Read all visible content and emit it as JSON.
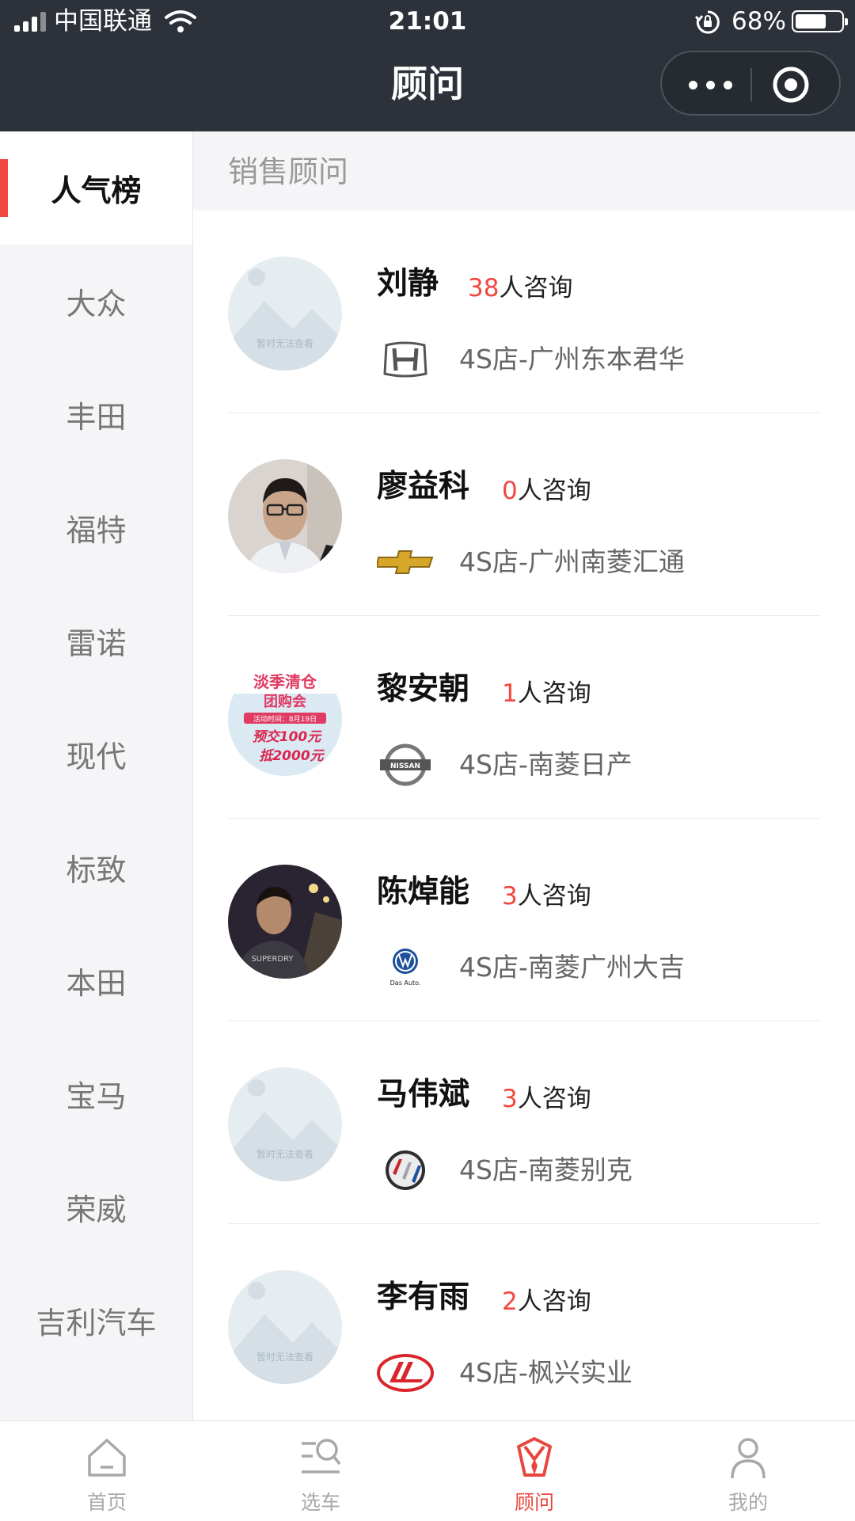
{
  "status_bar": {
    "carrier": "中国联通",
    "time": "21:01",
    "battery_percent_text": "68%",
    "battery_level": 0.68
  },
  "nav": {
    "title": "顾问",
    "more_icon": "more-dots-icon",
    "close_icon": "target-close-icon"
  },
  "sidebar": {
    "items": [
      {
        "label": "人气榜",
        "active": true
      },
      {
        "label": "大众"
      },
      {
        "label": "丰田"
      },
      {
        "label": "福特"
      },
      {
        "label": "雷诺"
      },
      {
        "label": "现代"
      },
      {
        "label": "标致"
      },
      {
        "label": "本田"
      },
      {
        "label": "宝马"
      },
      {
        "label": "荣威"
      },
      {
        "label": "吉利汽车"
      }
    ]
  },
  "list": {
    "section_title": "销售顾问",
    "consult_suffix": "人咨询",
    "advisors": [
      {
        "name": "刘静",
        "consult_count": "38",
        "store": "4S店-广州东本君华",
        "brand_icon": "honda-logo-icon",
        "avatar": "placeholder",
        "avatar_text": "暂时无法查看"
      },
      {
        "name": "廖益科",
        "consult_count": "0",
        "store": "4S店-广州南菱汇通",
        "brand_icon": "chevrolet-logo-icon",
        "avatar": "photo"
      },
      {
        "name": "黎安朝",
        "consult_count": "1",
        "store": "4S店-南菱日产",
        "brand_icon": "nissan-logo-icon",
        "avatar": "promo",
        "avatar_text": {
          "line1": "淡季清仓",
          "line2": "团购会",
          "line3": "活动时间：8月19日",
          "line4": "预交100元",
          "line5": "抵2000元"
        },
        "brand_text": "NISSAN"
      },
      {
        "name": "陈焯能",
        "consult_count": "3",
        "store": "4S店-南菱广州大吉",
        "brand_icon": "volkswagen-logo-icon",
        "avatar": "photo",
        "brand_text": "Das Auto."
      },
      {
        "name": "马伟斌",
        "consult_count": "3",
        "store": "4S店-南菱别克",
        "brand_icon": "buick-logo-icon",
        "avatar": "placeholder",
        "avatar_text": "暂时无法查看"
      },
      {
        "name": "李有雨",
        "consult_count": "2",
        "store": "4S店-枫兴实业",
        "brand_icon": "lifan-logo-icon",
        "avatar": "placeholder",
        "avatar_text": "暂时无法查看"
      }
    ]
  },
  "tabbar": {
    "tabs": [
      {
        "label": "首页",
        "icon": "home-icon"
      },
      {
        "label": "选车",
        "icon": "car-search-icon"
      },
      {
        "label": "顾问",
        "icon": "advisor-icon",
        "active": true
      },
      {
        "label": "我的",
        "icon": "profile-icon"
      }
    ]
  },
  "colors": {
    "accent": "#f2473f",
    "topbar": "#2c313a",
    "sidebar_bg": "#f5f5f7",
    "tab_active": "#e8473f",
    "tab_inactive": "#a8a8a8"
  }
}
